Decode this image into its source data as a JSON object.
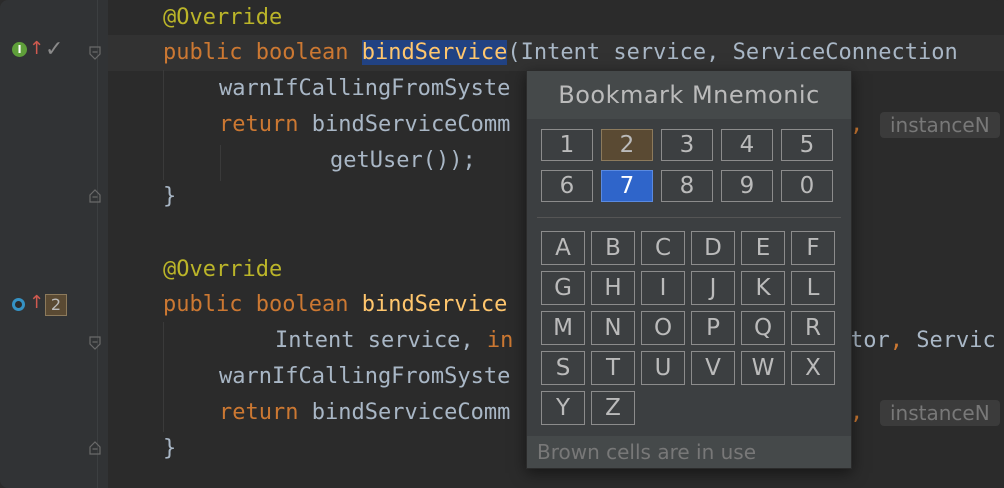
{
  "colors": {
    "background": "#2b2b2b",
    "keyword": "#cc7832",
    "annotation": "#bbb529",
    "method": "#ffc66d",
    "selection": "#214283",
    "used_cell": "#5a4a33",
    "selected_cell": "#2f65ca"
  },
  "code": {
    "line1": {
      "annotation": "@Override"
    },
    "line2": {
      "kw1": "public",
      "kw2": "boolean",
      "name": "bindService",
      "rest": "(Intent service, ServiceConnection"
    },
    "line3": {
      "text": "warnIfCallingFromSyste"
    },
    "line4": {
      "kw": "return",
      "text": "bindServiceComm",
      "comma": ",",
      "hint": "instanceN"
    },
    "line5": {
      "text": "getUser());"
    },
    "line6": {
      "text": "}"
    },
    "line7": {
      "annotation": "@Override"
    },
    "line8": {
      "kw1": "public",
      "kw2": "boolean",
      "name": "bindService"
    },
    "line9": {
      "p1": "Intent service, ",
      "kw": "in",
      "p2": "tor",
      "comma": ",",
      "p3": " Servic"
    },
    "line10": {
      "text": "warnIfCallingFromSyste"
    },
    "line11": {
      "kw": "return",
      "text": "bindServiceComm",
      "comma": ",",
      "hint": "instanceN"
    },
    "line12": {
      "text": "}"
    }
  },
  "gutter": {
    "implements_badge": "I",
    "overrides_count": "2"
  },
  "popup": {
    "title": "Bookmark Mnemonic",
    "digits_row1": [
      "1",
      "2",
      "3",
      "4",
      "5"
    ],
    "digits_row2": [
      "6",
      "7",
      "8",
      "9",
      "0"
    ],
    "used": [
      "2"
    ],
    "selected": "7",
    "letters": [
      "A",
      "B",
      "C",
      "D",
      "E",
      "F",
      "G",
      "H",
      "I",
      "J",
      "K",
      "L",
      "M",
      "N",
      "O",
      "P",
      "Q",
      "R",
      "S",
      "T",
      "U",
      "V",
      "W",
      "X",
      "Y",
      "Z"
    ],
    "footer": "Brown cells are in use"
  }
}
